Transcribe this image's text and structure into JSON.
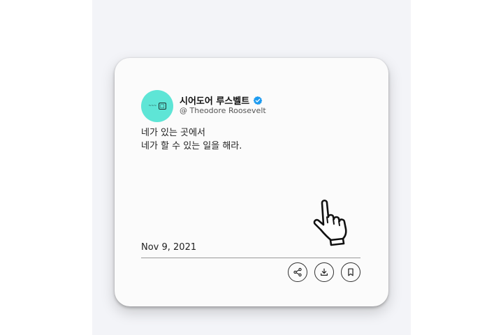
{
  "author": {
    "name": "시어도어 루스벨트",
    "handle": "@ Theodore Roosevelt",
    "avatar_icon": "avatar-logo",
    "verified_color": "#1d9bf0"
  },
  "quote": {
    "line1": "네가 있는 곳에서",
    "line2": "네가 할 수 있는 일을 해라."
  },
  "date": "Nov 9, 2021",
  "actions": [
    {
      "icon": "share-icon"
    },
    {
      "icon": "download-icon"
    },
    {
      "icon": "bookmark-icon"
    }
  ],
  "cursor_icon": "hand-pointer-icon",
  "colors": {
    "background": "#f3f4f8",
    "card": "#fbfbfb",
    "avatar": "#5ee5d6"
  }
}
